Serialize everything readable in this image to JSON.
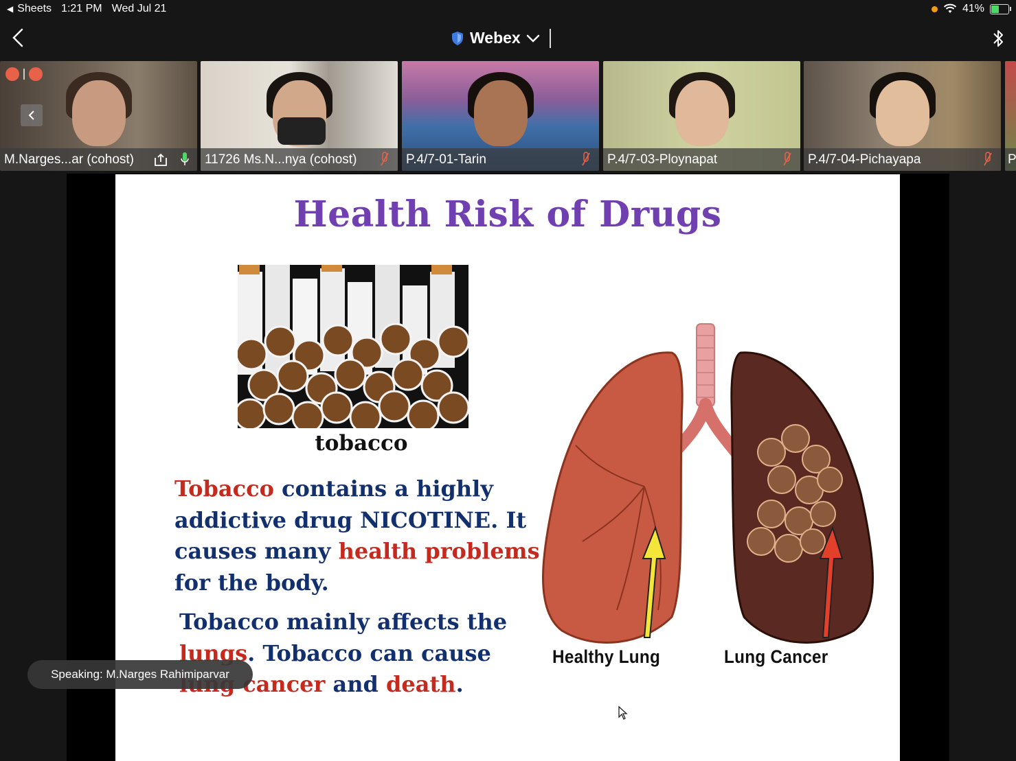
{
  "status_bar": {
    "back_app": "Sheets",
    "time": "1:21 PM",
    "date": "Wed Jul 21",
    "battery": "41%",
    "battery_level": 0.41,
    "indicator_color": "#f39c12"
  },
  "title_bar": {
    "app_name": "Webex",
    "back_icon": "chevron-left-icon",
    "right_icon": "bluetooth-icon"
  },
  "participants": [
    {
      "name": "M.Narges...ar (cohost)",
      "mic": "on"
    },
    {
      "name": "11726 Ms.N...nya (cohost)",
      "mic": "muted"
    },
    {
      "name": "P.4/7-01-Tarin",
      "mic": "muted"
    },
    {
      "name": "P.4/7-03-Ploynapat",
      "mic": "muted"
    },
    {
      "name": "P.4/7-04-Pichayapa",
      "mic": "muted"
    },
    {
      "name": "P"
    }
  ],
  "slide": {
    "title": "Health Risk of Drugs",
    "image_caption": "tobacco",
    "para1": {
      "w1": "Tobacco",
      "w2": " contains a highly addictive drug NICOTINE. It causes many ",
      "w3": "health problems",
      "w4": " for the body."
    },
    "para2": {
      "w1": "Tobacco mainly affects the ",
      "w2": "lungs",
      "w3": ". Tobacco can cause ",
      "w4": "lung cancer",
      "w5": " and ",
      "w6": "death",
      "w7": "."
    },
    "label_healthy": "Healthy Lung",
    "label_cancer": "Lung Cancer"
  },
  "speaking_indicator": "Speaking: M.Narges Rahimiparvar",
  "colors": {
    "title_purple": "#7040b0",
    "text_navy": "#12306d",
    "text_red": "#c52a1f"
  }
}
